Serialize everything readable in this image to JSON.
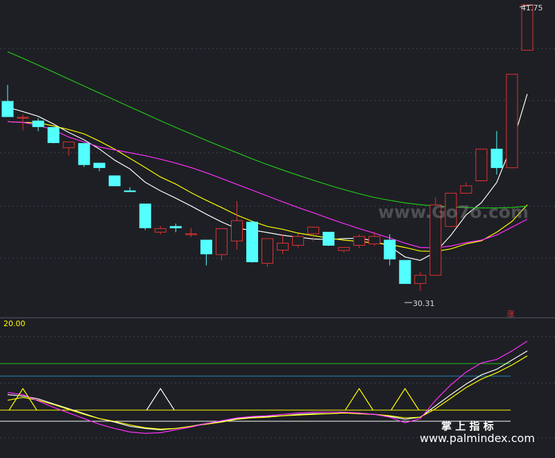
{
  "chart_data": {
    "type": "candlestick",
    "annotations": {
      "high_label": "41.75",
      "low_label": "30.31",
      "limit_up_mark": "涨"
    },
    "price_axis_ticks": [
      "41.75",
      "30.31"
    ],
    "candles": [
      {
        "o": 36.38,
        "h": 37.29,
        "l": 35.65,
        "c": 35.53
      },
      {
        "o": 35.49,
        "h": 35.65,
        "l": 34.77,
        "c": 35.49
      },
      {
        "o": 35.29,
        "h": 35.45,
        "l": 34.72,
        "c": 34.97
      },
      {
        "o": 34.93,
        "h": 34.93,
        "l": 34.04,
        "c": 34.08
      },
      {
        "o": 33.8,
        "h": 34.08,
        "l": 33.36,
        "c": 34.12
      },
      {
        "o": 34.04,
        "h": 34.04,
        "l": 32.73,
        "c": 32.86
      },
      {
        "o": 32.94,
        "h": 32.94,
        "l": 32.49,
        "c": 32.69
      },
      {
        "o": 32.24,
        "h": 32.24,
        "l": 31.65,
        "c": 31.68
      },
      {
        "o": 31.4,
        "h": 31.6,
        "l": 31.36,
        "c": 31.36
      },
      {
        "o": 30.67,
        "h": 30.67,
        "l": 29.22,
        "c": 29.34
      },
      {
        "o": 29.1,
        "h": 29.44,
        "l": 28.98,
        "c": 29.3
      },
      {
        "o": 29.42,
        "h": 29.58,
        "l": 29.1,
        "c": 29.34
      },
      {
        "o": 29.01,
        "h": 29.34,
        "l": 28.82,
        "c": 29.01
      },
      {
        "o": 28.66,
        "h": 28.66,
        "l": 27.25,
        "c": 27.89
      },
      {
        "o": 27.85,
        "h": 29.22,
        "l": 27.53,
        "c": 29.3
      },
      {
        "o": 28.61,
        "h": 30.83,
        "l": 28.13,
        "c": 29.74
      },
      {
        "o": 29.66,
        "h": 29.74,
        "l": 27.41,
        "c": 27.45
      },
      {
        "o": 27.37,
        "h": 28.74,
        "l": 27.17,
        "c": 28.74
      },
      {
        "o": 28.1,
        "h": 28.98,
        "l": 27.89,
        "c": 28.49
      },
      {
        "o": 28.37,
        "h": 29.01,
        "l": 28.25,
        "c": 28.86
      },
      {
        "o": 29.01,
        "h": 29.42,
        "l": 28.58,
        "c": 29.38
      },
      {
        "o": 29.1,
        "h": 29.1,
        "l": 28.33,
        "c": 28.37
      },
      {
        "o": 28.08,
        "h": 28.21,
        "l": 27.97,
        "c": 28.25
      },
      {
        "o": 28.37,
        "h": 28.98,
        "l": 28.21,
        "c": 28.86
      },
      {
        "o": 28.45,
        "h": 29.1,
        "l": 28.33,
        "c": 28.86
      },
      {
        "o": 28.66,
        "h": 28.98,
        "l": 27.25,
        "c": 27.61
      },
      {
        "o": 27.53,
        "h": 27.53,
        "l": 26.24,
        "c": 26.24
      },
      {
        "o": 26.24,
        "h": 26.9,
        "l": 25.84,
        "c": 26.7
      },
      {
        "o": 26.7,
        "h": 31.03,
        "l": 26.7,
        "c": 30.62
      },
      {
        "o": 29.42,
        "h": 31.27,
        "l": 29.42,
        "c": 31.27
      },
      {
        "o": 31.27,
        "h": 31.87,
        "l": 31.27,
        "c": 31.68
      },
      {
        "o": 31.96,
        "h": 33.72,
        "l": 31.96,
        "c": 33.72
      },
      {
        "o": 33.72,
        "h": 34.73,
        "l": 32.31,
        "c": 32.69
      },
      {
        "o": 32.69,
        "h": 37.89,
        "l": 32.69,
        "c": 37.89
      },
      {
        "o": 39.23,
        "h": 41.75,
        "l": 39.23,
        "c": 41.75
      }
    ],
    "series": [
      {
        "name": "",
        "color": "#ffffff",
        "values": [
          36.05,
          35.81,
          35.55,
          35.12,
          34.65,
          34.24,
          33.73,
          33.11,
          32.62,
          31.88,
          31.4,
          30.99,
          30.56,
          30.1,
          29.67,
          29.3,
          29.22,
          29.08,
          28.93,
          28.82,
          28.72,
          28.69,
          28.74,
          28.77,
          28.61,
          28.31,
          27.72,
          27.53,
          27.99,
          28.93,
          30.06,
          30.74,
          31.87,
          33.96,
          36.79
        ]
      },
      {
        "name": "",
        "color": "#ffff00",
        "values": [
          35.25,
          35.21,
          35.19,
          35.01,
          34.81,
          34.57,
          34.17,
          33.72,
          33.21,
          32.7,
          32.17,
          31.78,
          31.3,
          30.87,
          30.47,
          30.05,
          29.71,
          29.42,
          29.26,
          29.05,
          28.91,
          28.77,
          28.66,
          28.58,
          28.5,
          28.41,
          28.25,
          28.05,
          28.03,
          28.17,
          28.45,
          28.62,
          29.1,
          29.7,
          30.62
        ]
      },
      {
        "name": "",
        "color": "#ff30ff",
        "values": [
          35.25,
          35.21,
          35.05,
          34.79,
          34.39,
          34.12,
          33.84,
          33.68,
          33.52,
          33.36,
          33.16,
          32.94,
          32.7,
          32.41,
          32.09,
          31.76,
          31.44,
          31.11,
          30.79,
          30.47,
          30.18,
          29.87,
          29.58,
          29.3,
          29.04,
          28.78,
          28.49,
          28.25,
          28.23,
          28.33,
          28.52,
          28.66,
          28.94,
          29.38,
          29.82
        ]
      },
      {
        "name": "",
        "color": "#22c51a",
        "values": [
          39.14,
          38.78,
          38.4,
          38.01,
          37.62,
          37.23,
          36.84,
          36.46,
          36.07,
          35.69,
          35.3,
          34.93,
          34.57,
          34.21,
          33.86,
          33.52,
          33.18,
          32.86,
          32.56,
          32.27,
          31.99,
          31.72,
          31.47,
          31.24,
          31.03,
          30.87,
          30.73,
          30.63,
          30.55,
          30.51,
          30.47,
          30.45,
          30.45,
          30.47,
          30.55
        ]
      }
    ],
    "indicator": {
      "label": "20.00",
      "levels": [
        {
          "value": 86,
          "color": "#22c51a"
        },
        {
          "value": 75,
          "color": "#1f88b8"
        },
        {
          "value": 20,
          "color": "#ffff00"
        },
        {
          "value": 12,
          "color": "#ffffff"
        }
      ],
      "series": [
        {
          "name": "",
          "color": "#ffffff",
          "values": [
            42,
            40,
            36,
            29,
            22,
            15,
            8,
            3,
            -3,
            -6,
            -8,
            -6,
            -3,
            1,
            4,
            8,
            10,
            11,
            12,
            14,
            15,
            15,
            16,
            15,
            14,
            11,
            7,
            10,
            26,
            42,
            57,
            70,
            78,
            91,
            104
          ]
        },
        {
          "name": "",
          "color": "#ffff00",
          "values": [
            34,
            38,
            34,
            28,
            21,
            14,
            8,
            4,
            -1,
            -5,
            -7,
            -6,
            -3,
            0,
            3,
            7,
            9,
            10,
            12,
            13,
            14,
            15,
            16,
            15,
            14,
            12,
            9,
            10,
            22,
            37,
            52,
            64,
            73,
            84,
            97
          ]
        },
        {
          "name": "",
          "color": "#ff30ff",
          "values": [
            45,
            42,
            33,
            24,
            16,
            8,
            0,
            -6,
            -11,
            -13,
            -12,
            -8,
            -4,
            1,
            5,
            9,
            11,
            12,
            14,
            16,
            17,
            17,
            17,
            16,
            14,
            10,
            2,
            8,
            34,
            56,
            74,
            87,
            92,
            104,
            118
          ]
        }
      ],
      "signals": [
        1,
        10,
        23,
        26
      ]
    }
  },
  "watermarks": {
    "top": "www.Go7o.com",
    "brand": "掌 上 指 标",
    "url": "www.palmindex.com"
  },
  "colors": {
    "up": "#e23232",
    "down": "#54ffff",
    "background": "#1e1f24",
    "grid": "#3e4452"
  }
}
